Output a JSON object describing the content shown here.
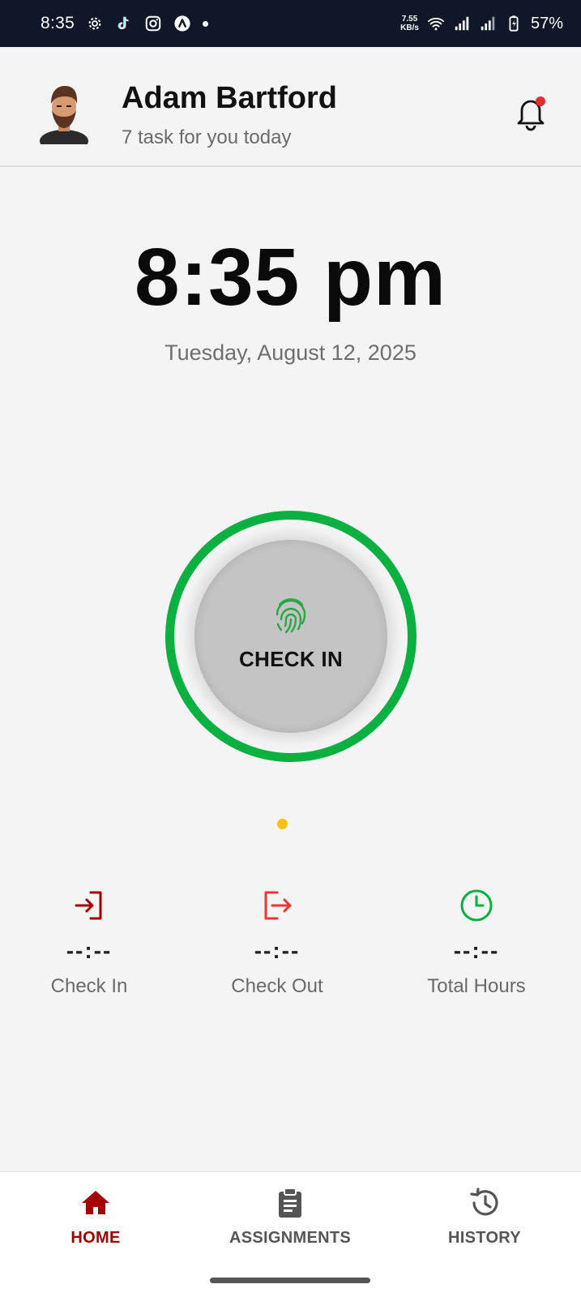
{
  "status_bar": {
    "time": "8:35",
    "net_speed_value": "7.55",
    "net_speed_unit": "KB/s",
    "battery": "57%",
    "icons": [
      "settings-icon",
      "tiktok-icon",
      "instagram-icon",
      "app-icon",
      "dot-icon",
      "wifi-icon",
      "signal-icon",
      "signal-icon",
      "battery-icon"
    ]
  },
  "header": {
    "user_name": "Adam Bartford",
    "subtitle": "7 task for you today",
    "has_notification": true
  },
  "clock": {
    "time": "8:35 pm",
    "date": "Tuesday, August 12, 2025"
  },
  "check_button": {
    "label": "CHECK IN",
    "icon": "fingerprint-icon"
  },
  "stats": [
    {
      "icon": "check-in-icon",
      "value": "--:--",
      "label": "Check In"
    },
    {
      "icon": "check-out-icon",
      "value": "--:--",
      "label": "Check Out"
    },
    {
      "icon": "clock-icon",
      "value": "--:--",
      "label": "Total Hours"
    }
  ],
  "bottom_nav": [
    {
      "icon": "home-icon",
      "label": "HOME",
      "active": true
    },
    {
      "icon": "clipboard-icon",
      "label": "ASSIGNMENTS",
      "active": false
    },
    {
      "icon": "history-icon",
      "label": "HISTORY",
      "active": false
    }
  ],
  "colors": {
    "status_bar_bg": "#0f1729",
    "accent_green": "#0ab040",
    "accent_red": "#a30000",
    "check_out_red": "#e53935",
    "indicator_yellow": "#f8c10a",
    "notification_dot": "#e82b2b"
  }
}
